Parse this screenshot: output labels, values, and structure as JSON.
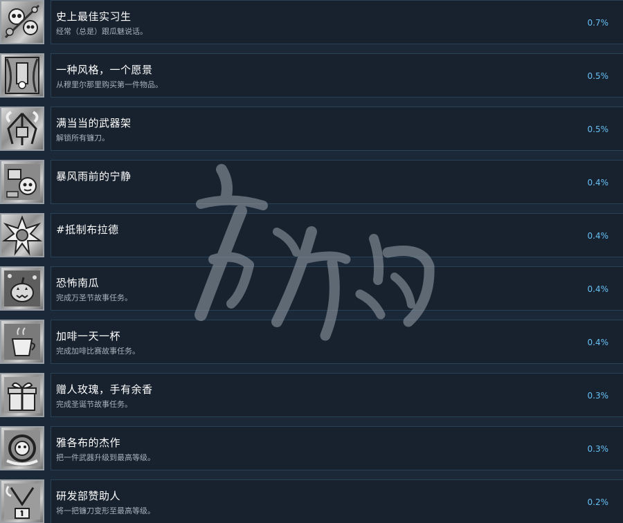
{
  "achievements": [
    {
      "title": "史上最佳实习生",
      "desc": "经常（总是）跟瓜魅说话。",
      "pct": "0.7%",
      "icon": "skull-collage-icon"
    },
    {
      "title": "一种风格，一个愿景",
      "desc": "从穆里尔那里购买第一件物品。",
      "pct": "0.5%",
      "icon": "curtain-shop-icon"
    },
    {
      "title": "满当当的武器架",
      "desc": "解锁所有镰刀。",
      "pct": "0.5%",
      "icon": "weapon-rack-icon"
    },
    {
      "title": "暴风雨前的宁静",
      "desc": "",
      "pct": "0.4%",
      "icon": "calm-room-icon"
    },
    {
      "title": "#抵制布拉德",
      "desc": "",
      "pct": "0.4%",
      "icon": "explosion-icon"
    },
    {
      "title": "恐怖南瓜",
      "desc": "完成万圣节故事任务。",
      "pct": "0.4%",
      "icon": "pumpkin-icon"
    },
    {
      "title": "加啡一天一杯",
      "desc": "完成加啡比赛故事任务。",
      "pct": "0.4%",
      "icon": "coffee-cup-icon"
    },
    {
      "title": "赠人玫瑰，手有余香",
      "desc": "完成圣诞节故事任务。",
      "pct": "0.3%",
      "icon": "gift-box-icon"
    },
    {
      "title": "雅各布的杰作",
      "desc": "把一件武器升级到最高等级。",
      "pct": "0.3%",
      "icon": "masterpiece-icon"
    },
    {
      "title": "研发部赞助人",
      "desc": "将一把镰刀变形至最高等级。",
      "pct": "0.2%",
      "icon": "trophy-podium-icon"
    }
  ],
  "colors": {
    "background": "#1b2838",
    "panel": "#18222f",
    "border": "#2a4256",
    "title": "#ffffff",
    "description": "#a7b1bb",
    "percent": "#66c0f4"
  }
}
